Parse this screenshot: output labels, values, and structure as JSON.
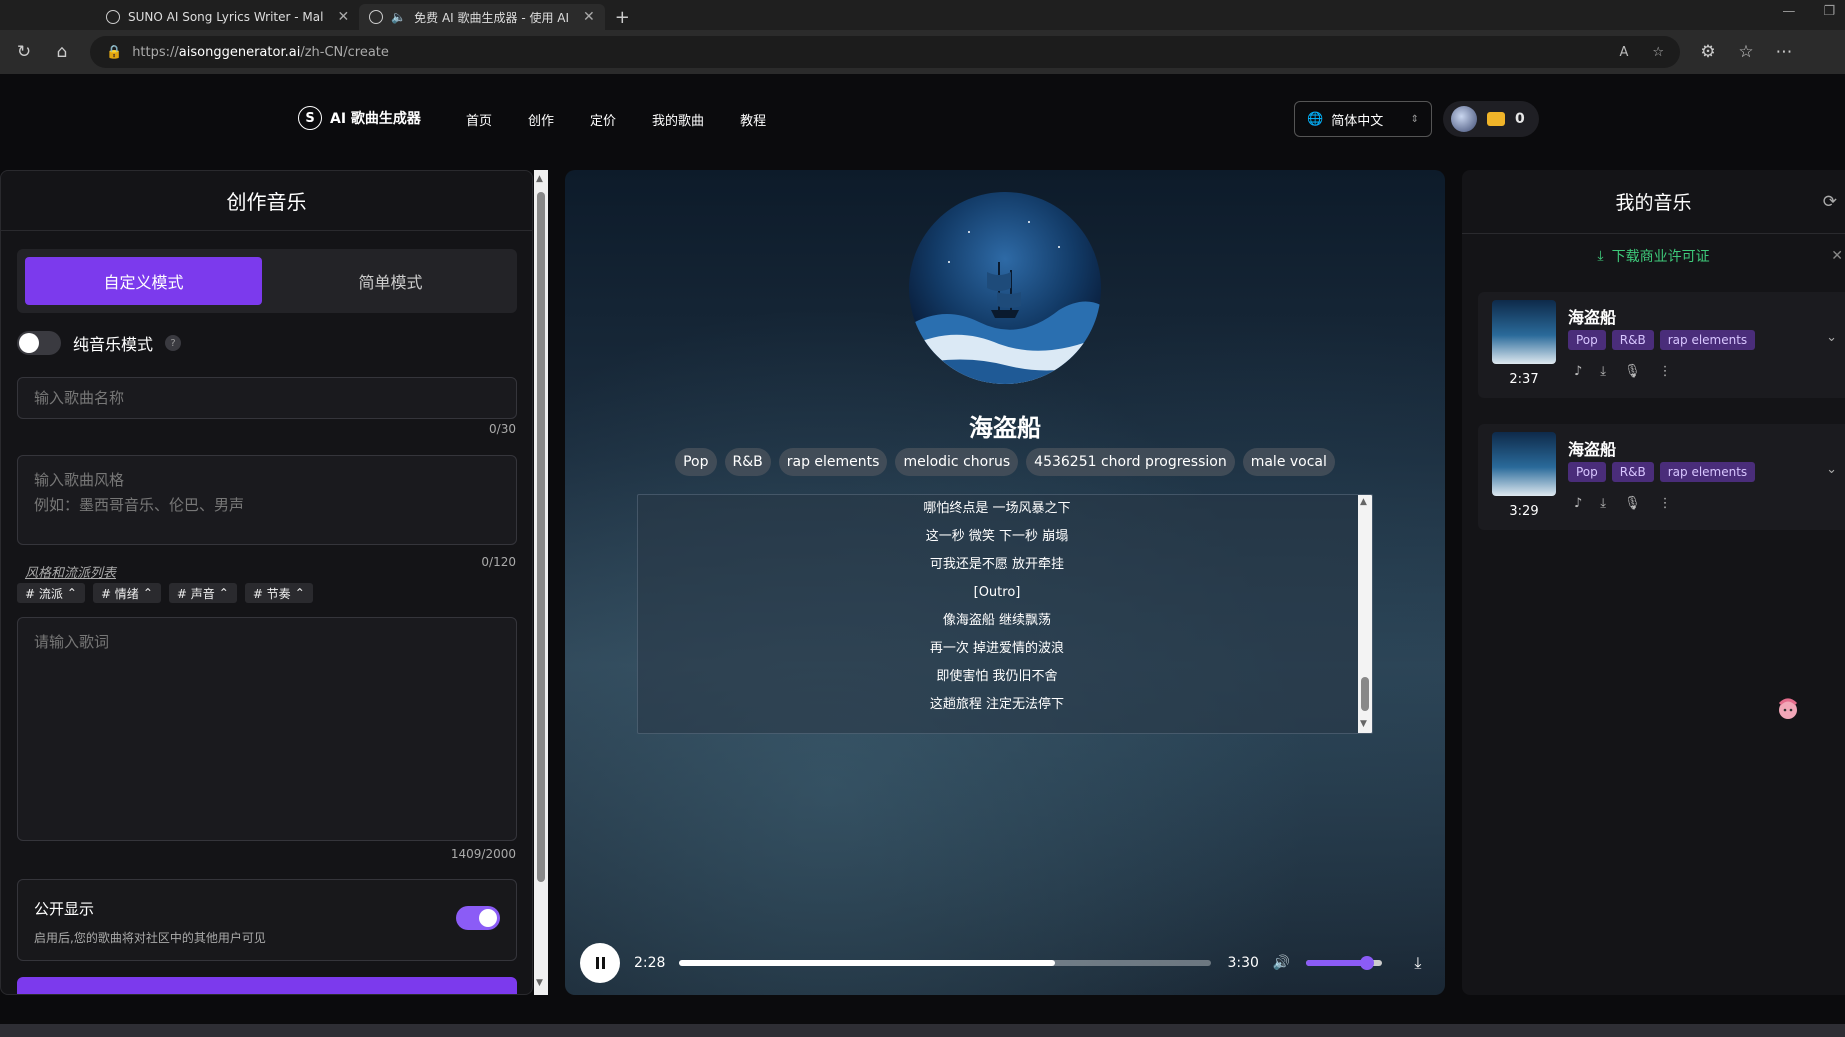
{
  "browser": {
    "tabs": [
      {
        "title": "SUNO AI Song Lyrics Writer - Mal"
      },
      {
        "title": "免费 AI 歌曲生成器 - 使用 AI"
      }
    ],
    "url_prefix": "https://",
    "url_host": "aisonggenerator.ai",
    "url_path": "/zh-CN/create"
  },
  "header": {
    "logo_letter": "S",
    "logo_text": "AI 歌曲生成器",
    "nav": [
      "首页",
      "创作",
      "定价",
      "我的歌曲",
      "教程"
    ],
    "language": "简体中文",
    "credits": "0"
  },
  "create": {
    "title": "创作音乐",
    "mode_custom": "自定义模式",
    "mode_simple": "简单模式",
    "instrumental_label": "纯音乐模式",
    "help": "?",
    "song_name_placeholder": "输入歌曲名称",
    "song_name_counter": "0/30",
    "style_placeholder_1": "输入歌曲风格",
    "style_placeholder_2": "例如：墨西哥音乐、伦巴、男声",
    "style_link": "风格和流派列表",
    "style_counter": "0/120",
    "chips": [
      "# 流派",
      "# 情绪",
      "# 声音",
      "# 节奏"
    ],
    "lyrics_placeholder": "请输入歌词",
    "lyrics_counter": "1409/2000",
    "public_title": "公开显示",
    "public_desc": "启用后,您的歌曲将对社区中的其他用户可见"
  },
  "player": {
    "song_title": "海盗船",
    "tags": [
      "Pop",
      "R&B",
      "rap elements",
      "melodic chorus",
      "4536251 chord progression",
      "male vocal"
    ],
    "lyrics": [
      "哪怕终点是 一场风暴之下",
      "这一秒 微笑 下一秒 崩塌",
      "可我还是不愿 放开牵挂",
      "[Outro]",
      "像海盗船 继续飘荡",
      "再一次 掉进爱情的波浪",
      "即使害怕 我仍旧不舍",
      "这趟旅程 注定无法停下"
    ],
    "current_time": "2:28",
    "total_time": "3:30",
    "progress": 0.705,
    "volume": 0.8
  },
  "my_music": {
    "title": "我的音乐",
    "license_link": "下载商业许可证",
    "songs": [
      {
        "title": "海盗船",
        "tags": [
          "Pop",
          "R&B",
          "rap elements"
        ],
        "duration": "2:37"
      },
      {
        "title": "海盗船",
        "tags": [
          "Pop",
          "R&B",
          "rap elements"
        ],
        "duration": "3:29"
      }
    ]
  },
  "colors": {
    "accent": "#7c3aed",
    "license_green": "#3ec97a"
  }
}
